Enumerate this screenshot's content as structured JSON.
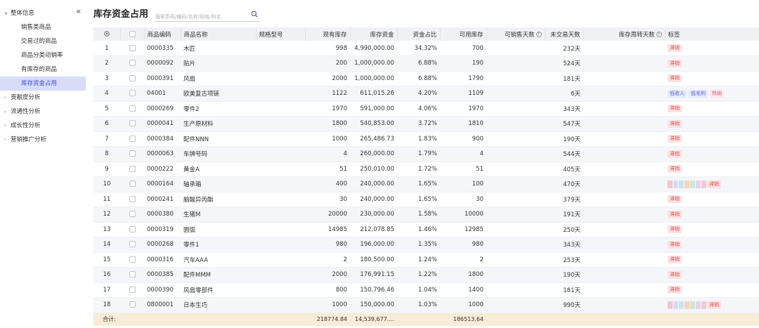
{
  "sidebar": {
    "groups": [
      {
        "label": "整体信息",
        "expanded": true
      },
      {
        "label": "贡献度分析",
        "expanded": false
      },
      {
        "label": "流通性分析",
        "expanded": false
      },
      {
        "label": "成长性分析",
        "expanded": false
      },
      {
        "label": "营销推广分析",
        "expanded": false
      }
    ],
    "sub_items": [
      {
        "label": "销售类商品"
      },
      {
        "label": "交易过的商品"
      },
      {
        "label": "商品分类动销率"
      },
      {
        "label": "有库存的商品"
      },
      {
        "label": "库存资金占用",
        "active": true
      }
    ],
    "collapse_glyph": "«"
  },
  "header": {
    "title": "库存资金占用",
    "search_placeholder": "搜索条码/编码/名称/规格/别名"
  },
  "table": {
    "columns": {
      "code": "商品编码",
      "name": "商品名称",
      "spec": "规格型号",
      "stock": "现有库存",
      "fund": "库存资金",
      "ratio": "资金占比",
      "avail": "可用库存",
      "sell_days": "可销售天数",
      "no_trade": "未交易天数",
      "turnover": "库存周转天数",
      "tags": "标签"
    },
    "rows": [
      {
        "idx": "1",
        "code": "0000335",
        "name": "木匠",
        "spec": "",
        "stock": "998",
        "fund": "4,990,000.00",
        "ratio": "34.32%",
        "avail": "700",
        "sell_days": "",
        "no_trade": "232天",
        "turnover": "",
        "tags": [
          {
            "text": "滞销",
            "kind": "hot"
          }
        ]
      },
      {
        "idx": "2",
        "code": "0000092",
        "name": "贴片",
        "spec": "",
        "stock": "200",
        "fund": "1,000,000.00",
        "ratio": "6.88%",
        "avail": "190",
        "sell_days": "",
        "no_trade": "524天",
        "turnover": "",
        "tags": [
          {
            "text": "滞销",
            "kind": "hot"
          }
        ]
      },
      {
        "idx": "3",
        "code": "0000391",
        "name": "风扇",
        "spec": "",
        "stock": "2000",
        "fund": "1,000,000.00",
        "ratio": "6.88%",
        "avail": "1790",
        "sell_days": "",
        "no_trade": "181天",
        "turnover": "",
        "tags": [
          {
            "text": "滞销",
            "kind": "hot"
          }
        ]
      },
      {
        "idx": "4",
        "code": "04001",
        "name": "欧美复古项链",
        "spec": "",
        "stock": "1122",
        "fund": "611,015.26",
        "ratio": "4.20%",
        "avail": "1109",
        "sell_days": "",
        "no_trade": "6天",
        "turnover": "",
        "tags": [
          {
            "text": "低收入",
            "kind": "low"
          },
          {
            "text": "低毛利",
            "kind": "low"
          },
          {
            "text": "热销",
            "kind": "hotsale"
          }
        ]
      },
      {
        "idx": "5",
        "code": "0000269",
        "name": "零件2",
        "spec": "",
        "stock": "1970",
        "fund": "591,000.00",
        "ratio": "4.06%",
        "avail": "1970",
        "sell_days": "",
        "no_trade": "343天",
        "turnover": "",
        "tags": [
          {
            "text": "滞销",
            "kind": "hot"
          }
        ]
      },
      {
        "idx": "6",
        "code": "0000041",
        "name": "生产原材料",
        "spec": "",
        "stock": "1800",
        "fund": "540,853.00",
        "ratio": "3.72%",
        "avail": "1810",
        "sell_days": "",
        "no_trade": "547天",
        "turnover": "",
        "tags": [
          {
            "text": "滞销",
            "kind": "hot"
          }
        ]
      },
      {
        "idx": "7",
        "code": "0000384",
        "name": "配件NNN",
        "spec": "",
        "stock": "1000",
        "fund": "265,486.73",
        "ratio": "1.83%",
        "avail": "900",
        "sell_days": "",
        "no_trade": "190天",
        "turnover": "",
        "tags": [
          {
            "text": "滞销",
            "kind": "hot"
          }
        ]
      },
      {
        "idx": "8",
        "code": "0000063",
        "name": "车牌号码",
        "spec": "",
        "stock": "4",
        "fund": "260,000.00",
        "ratio": "1.79%",
        "avail": "4",
        "sell_days": "",
        "no_trade": "544天",
        "turnover": "",
        "tags": [
          {
            "text": "滞销",
            "kind": "hot"
          }
        ]
      },
      {
        "idx": "9",
        "code": "0000222",
        "name": "黄金A",
        "spec": "",
        "stock": "51",
        "fund": "250,010.00",
        "ratio": "1.72%",
        "avail": "51",
        "sell_days": "",
        "no_trade": "405天",
        "turnover": "",
        "tags": [
          {
            "text": "滞销",
            "kind": "hot"
          }
        ]
      },
      {
        "idx": "10",
        "code": "0000164",
        "name": "轴承箱",
        "spec": "",
        "stock": "400",
        "fund": "240,000.00",
        "ratio": "1.65%",
        "avail": "100",
        "sell_days": "",
        "no_trade": "470天",
        "turnover": "",
        "tags": [
          {
            "text": "滞销",
            "kind": "hot"
          }
        ],
        "color_blocks": true
      },
      {
        "idx": "11",
        "code": "0000241",
        "name": "脑酸异丙酯",
        "spec": "",
        "stock": "30",
        "fund": "240,000.00",
        "ratio": "1.65%",
        "avail": "30",
        "sell_days": "",
        "no_trade": "379天",
        "turnover": "",
        "tags": [
          {
            "text": "滞销",
            "kind": "hot"
          }
        ]
      },
      {
        "idx": "12",
        "code": "0000380",
        "name": "生猪M",
        "spec": "",
        "stock": "20000",
        "fund": "230,000.00",
        "ratio": "1.58%",
        "avail": "10000",
        "sell_days": "",
        "no_trade": "191天",
        "turnover": "",
        "tags": [
          {
            "text": "滞销",
            "kind": "hot"
          }
        ]
      },
      {
        "idx": "13",
        "code": "0000319",
        "name": "圆弧",
        "spec": "",
        "stock": "14985",
        "fund": "212,078.85",
        "ratio": "1.46%",
        "avail": "12985",
        "sell_days": "",
        "no_trade": "250天",
        "turnover": "",
        "tags": [
          {
            "text": "滞销",
            "kind": "hot"
          }
        ]
      },
      {
        "idx": "14",
        "code": "0000268",
        "name": "零件1",
        "spec": "",
        "stock": "980",
        "fund": "196,000.00",
        "ratio": "1.35%",
        "avail": "980",
        "sell_days": "",
        "no_trade": "343天",
        "turnover": "",
        "tags": [
          {
            "text": "滞销",
            "kind": "hot"
          }
        ]
      },
      {
        "idx": "15",
        "code": "0000316",
        "name": "汽车AAA",
        "spec": "",
        "stock": "2",
        "fund": "180,500.00",
        "ratio": "1.24%",
        "avail": "2",
        "sell_days": "",
        "no_trade": "253天",
        "turnover": "",
        "tags": [
          {
            "text": "滞销",
            "kind": "hot"
          }
        ]
      },
      {
        "idx": "16",
        "code": "0000385",
        "name": "配件MMM",
        "spec": "",
        "stock": "2000",
        "fund": "176,991.15",
        "ratio": "1.22%",
        "avail": "1800",
        "sell_days": "",
        "no_trade": "190天",
        "turnover": "",
        "tags": [
          {
            "text": "滞销",
            "kind": "hot"
          }
        ]
      },
      {
        "idx": "17",
        "code": "0000390",
        "name": "风扇零部件",
        "spec": "",
        "stock": "800",
        "fund": "150,796.46",
        "ratio": "1.04%",
        "avail": "1400",
        "sell_days": "",
        "no_trade": "181天",
        "turnover": "",
        "tags": [
          {
            "text": "滞销",
            "kind": "hot"
          }
        ]
      },
      {
        "idx": "18",
        "code": "0800001",
        "name": "日本生巧",
        "spec": "",
        "stock": "1000",
        "fund": "150,000.00",
        "ratio": "1.03%",
        "avail": "1000",
        "sell_days": "",
        "no_trade": "990天",
        "turnover": "",
        "tags": [
          {
            "text": "滞销",
            "kind": "hot"
          }
        ],
        "color_blocks": true
      }
    ],
    "footer": {
      "label": "合计:",
      "stock": "218774.84",
      "fund": "14,539,677....",
      "avail": "186513.64"
    },
    "block_colors": [
      "#f3c4cf",
      "#d7dcf5",
      "#c9e4f2",
      "#f6d5b8",
      "#cfe8d2",
      "#e4d3f0",
      "#f5c8d4"
    ]
  }
}
